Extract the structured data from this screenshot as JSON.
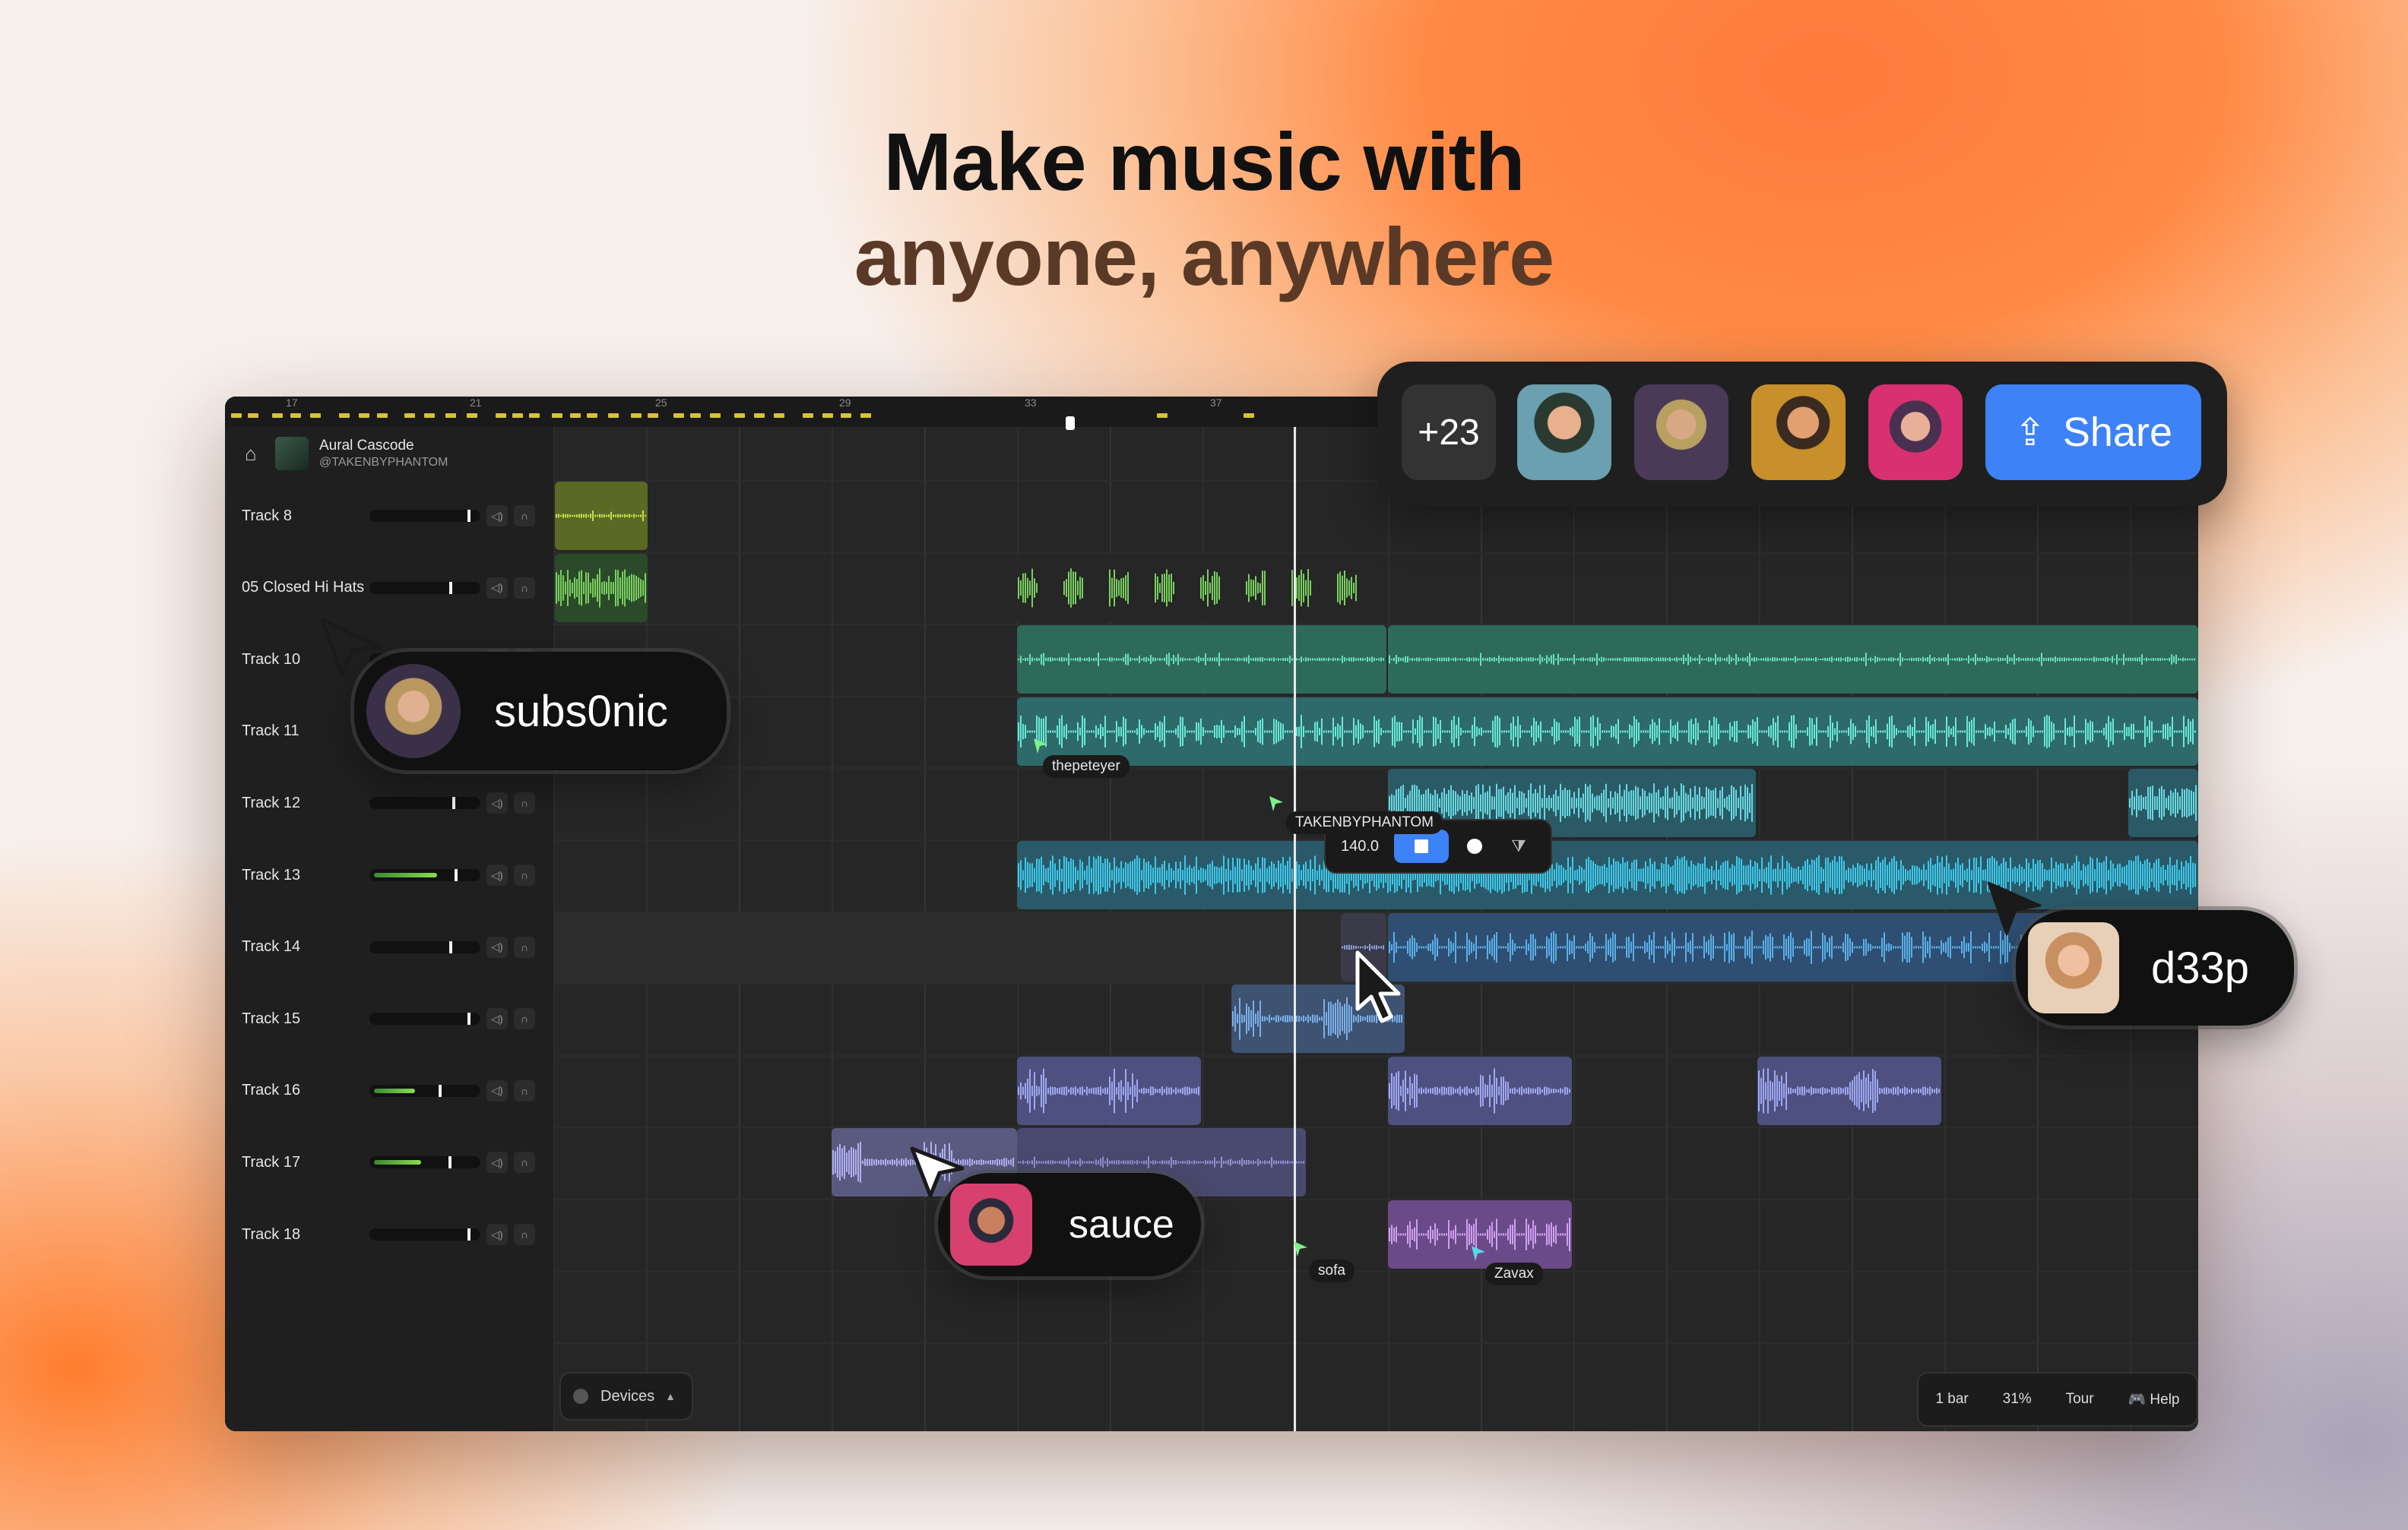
{
  "hero": {
    "line1": "Make music with",
    "line2": "anyone, anywhere"
  },
  "ruler": {
    "bars": [
      "17",
      "21",
      "25",
      "29",
      "33",
      "37"
    ]
  },
  "project": {
    "name": "Aural Cascode",
    "owner": "@TAKENBYPHANTOM"
  },
  "tracks": [
    {
      "name": "Track 8",
      "level": 0,
      "vol": 0.92
    },
    {
      "name": "05 Closed Hi Hats",
      "level": 0,
      "vol": 0.75
    },
    {
      "name": "Track 10",
      "level": 0,
      "vol": 0.8
    },
    {
      "name": "Track 11",
      "level": 0,
      "vol": 0.8
    },
    {
      "name": "Track 12",
      "level": 0,
      "vol": 0.78
    },
    {
      "name": "Track 13",
      "level": 0.62,
      "vol": 0.8
    },
    {
      "name": "Track 14",
      "level": 0,
      "vol": 0.75
    },
    {
      "name": "Track 15",
      "level": 0,
      "vol": 0.92
    },
    {
      "name": "Track 16",
      "level": 0.4,
      "vol": 0.65
    },
    {
      "name": "Track 17",
      "level": 0.46,
      "vol": 0.74
    },
    {
      "name": "Track 18",
      "level": 0,
      "vol": 0.92
    }
  ],
  "transport": {
    "bpm": "140.0"
  },
  "collab": {
    "count": "+23",
    "share_label": "Share"
  },
  "presence": {
    "subs0nic": "subs0nic",
    "d33p": "d33p",
    "sauce": "sauce",
    "thepeteyer": "thepeteyer",
    "takenbyphantom": "TAKENBYPHANTOM",
    "sofa": "sofa",
    "zavax": "Zavax"
  },
  "devices": {
    "label": "Devices"
  },
  "status": {
    "grid": "1 bar",
    "zoom": "31%",
    "tour": "Tour",
    "help": "Help"
  },
  "colors": {
    "accent": "#3d82f6",
    "track_green": "#3ea08a",
    "track_cyan": "#3fb6d6",
    "track_blue": "#4a80b8",
    "track_purple": "#8a88cc",
    "track_yellow": "#d8c238"
  }
}
